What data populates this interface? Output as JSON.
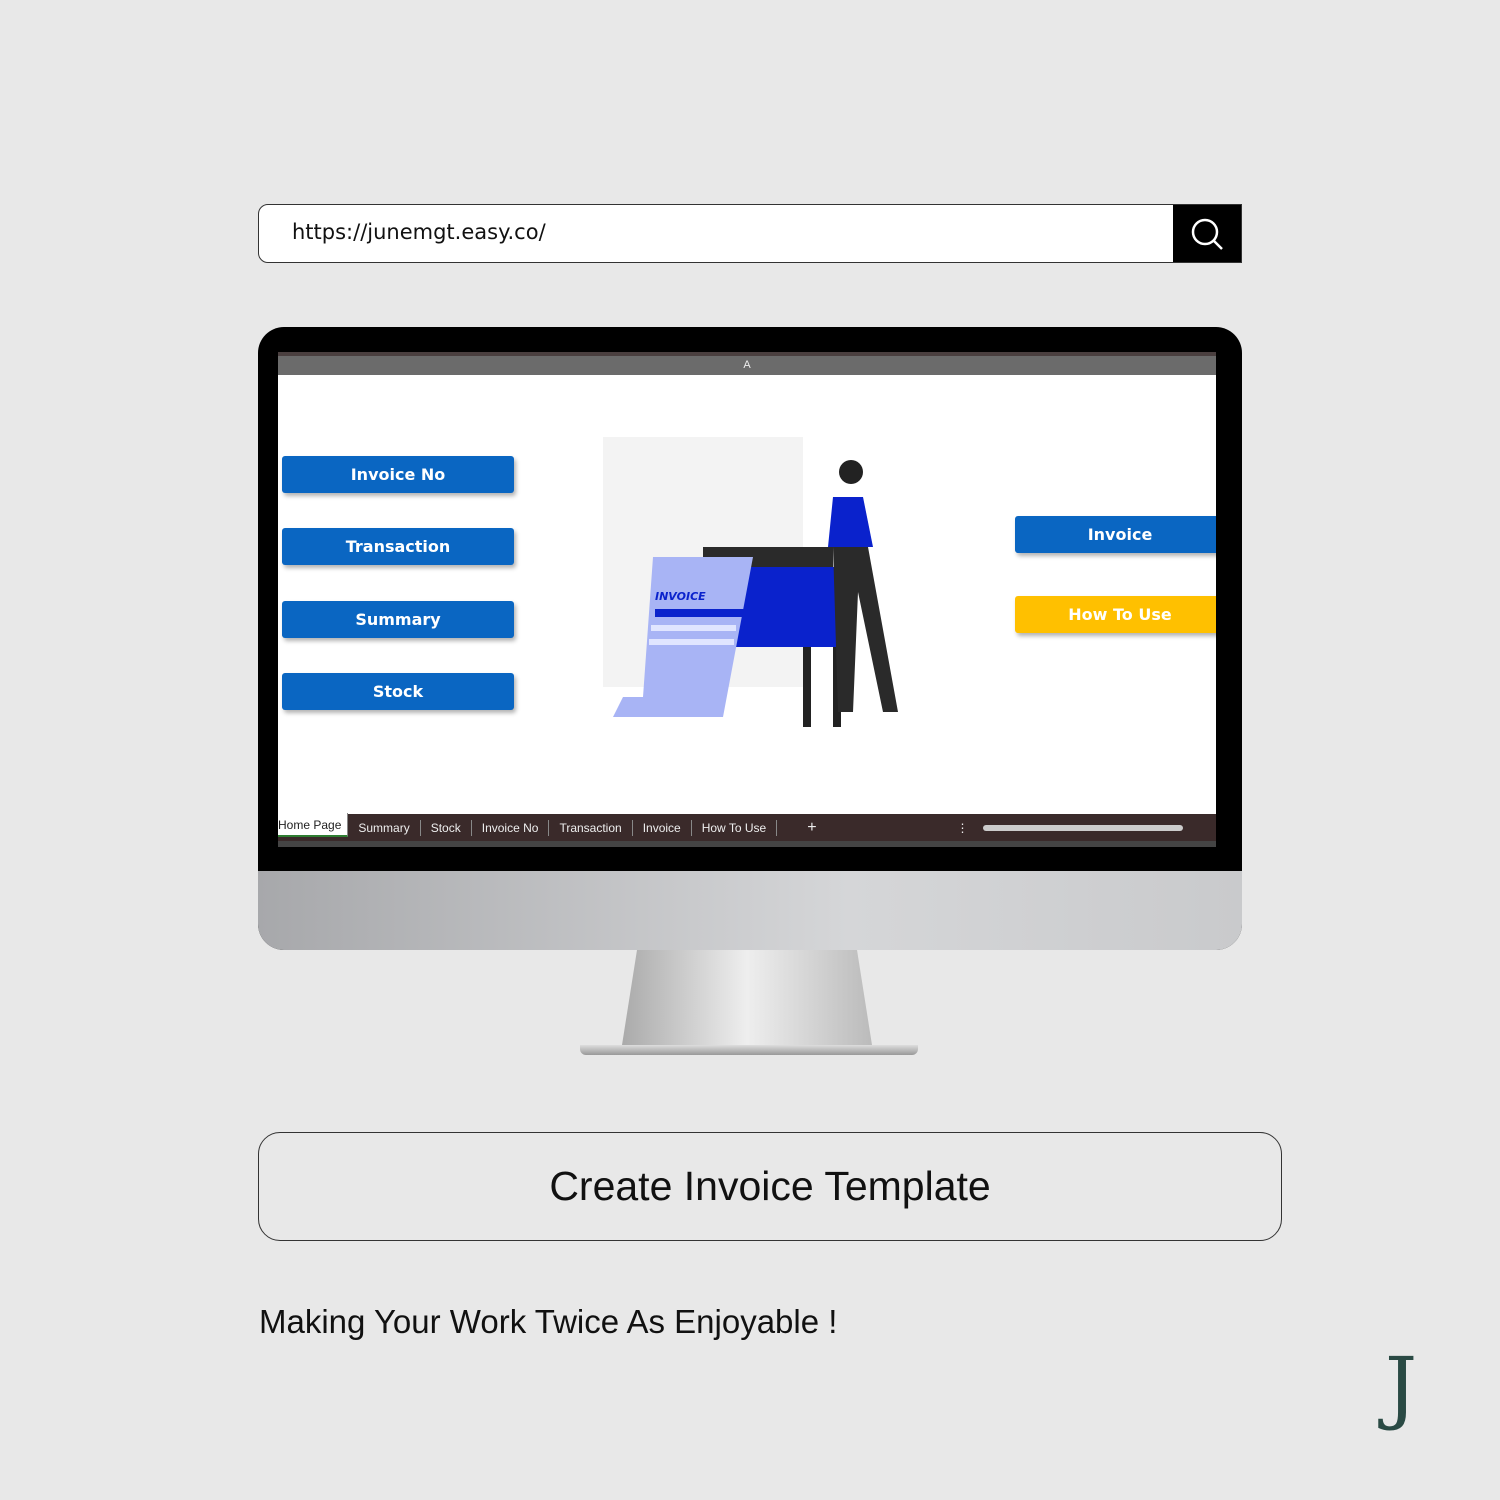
{
  "address_bar": {
    "url": "https://junemgt.easy.co/",
    "search_icon": "search-icon"
  },
  "spreadsheet": {
    "column_header": "A",
    "left_buttons": [
      "Invoice No",
      "Transaction",
      "Summary",
      "Stock"
    ],
    "right_buttons": [
      {
        "label": "Invoice",
        "color": "#0a66c2"
      },
      {
        "label": "How To Use",
        "color": "#ffc000"
      }
    ],
    "illustration_text": "INVOICE",
    "sheet_tabs": [
      "Home Page",
      "Summary",
      "Stock",
      "Invoice No",
      "Transaction",
      "Invoice",
      "How To Use"
    ],
    "active_tab": "Home Page",
    "add_sheet": "+"
  },
  "cta": {
    "label": "Create Invoice Template"
  },
  "tagline": "Making Your Work Twice As Enjoyable !",
  "logo": "J"
}
